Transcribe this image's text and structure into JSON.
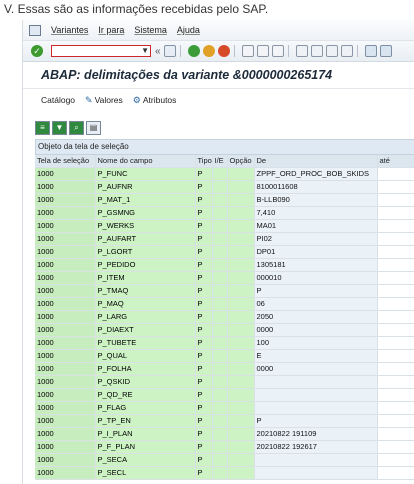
{
  "caption": "V. Essas são as informações recebidas pelo SAP.",
  "menu": {
    "items": [
      "Variantes",
      "Ir para",
      "Sistema",
      "Ajuda"
    ]
  },
  "title": "ABAP: delimitações da variante &0000000265174",
  "app_toolbar": {
    "catalog": "Catálogo",
    "values": "Valores",
    "attributes": "Atributos"
  },
  "group_header": "Objeto da tela de seleção",
  "table": {
    "headers": [
      "Tela de seleção",
      "Nome do campo",
      "Tipo",
      "I/E",
      "Opção",
      "De",
      "até"
    ],
    "rows": [
      [
        "1000",
        "P_FUNC",
        "P",
        "",
        "",
        "ZPPF_ORD_PROC_BOB_SKIDS",
        ""
      ],
      [
        "1000",
        "P_AUFNR",
        "P",
        "",
        "",
        "8100011608",
        ""
      ],
      [
        "1000",
        "P_MAT_1",
        "P",
        "",
        "",
        "B-LLB090",
        ""
      ],
      [
        "1000",
        "P_GSMNG",
        "P",
        "",
        "",
        "7,410",
        ""
      ],
      [
        "1000",
        "P_WERKS",
        "P",
        "",
        "",
        "MA01",
        ""
      ],
      [
        "1000",
        "P_AUFART",
        "P",
        "",
        "",
        "PI02",
        ""
      ],
      [
        "1000",
        "P_LGORT",
        "P",
        "",
        "",
        "DP01",
        ""
      ],
      [
        "1000",
        "P_PEDIDO",
        "P",
        "",
        "",
        "1305181",
        ""
      ],
      [
        "1000",
        "P_ITEM",
        "P",
        "",
        "",
        "000010",
        ""
      ],
      [
        "1000",
        "P_TMAQ",
        "P",
        "",
        "",
        "P",
        ""
      ],
      [
        "1000",
        "P_MAQ",
        "P",
        "",
        "",
        "06",
        ""
      ],
      [
        "1000",
        "P_LARG",
        "P",
        "",
        "",
        "2050",
        ""
      ],
      [
        "1000",
        "P_DIAEXT",
        "P",
        "",
        "",
        "0000",
        ""
      ],
      [
        "1000",
        "P_TUBETE",
        "P",
        "",
        "",
        "100",
        ""
      ],
      [
        "1000",
        "P_QUAL",
        "P",
        "",
        "",
        "E",
        ""
      ],
      [
        "1000",
        "P_FOLHA",
        "P",
        "",
        "",
        "0000",
        ""
      ],
      [
        "1000",
        "P_QSKID",
        "P",
        "",
        "",
        "",
        ""
      ],
      [
        "1000",
        "P_QD_RE",
        "P",
        "",
        "",
        "",
        ""
      ],
      [
        "1000",
        "P_FLAG",
        "P",
        "",
        "",
        "",
        ""
      ],
      [
        "1000",
        "P_TP_EN",
        "P",
        "",
        "",
        "P",
        ""
      ],
      [
        "1000",
        "P_I_PLAN",
        "P",
        "",
        "",
        "20210822 191109",
        ""
      ],
      [
        "1000",
        "P_F_PLAN",
        "P",
        "",
        "",
        "20210822 192617",
        ""
      ],
      [
        "1000",
        "P_SECA",
        "P",
        "",
        "",
        "",
        ""
      ],
      [
        "1000",
        "P_SECL",
        "P",
        "",
        "",
        "",
        ""
      ]
    ]
  }
}
